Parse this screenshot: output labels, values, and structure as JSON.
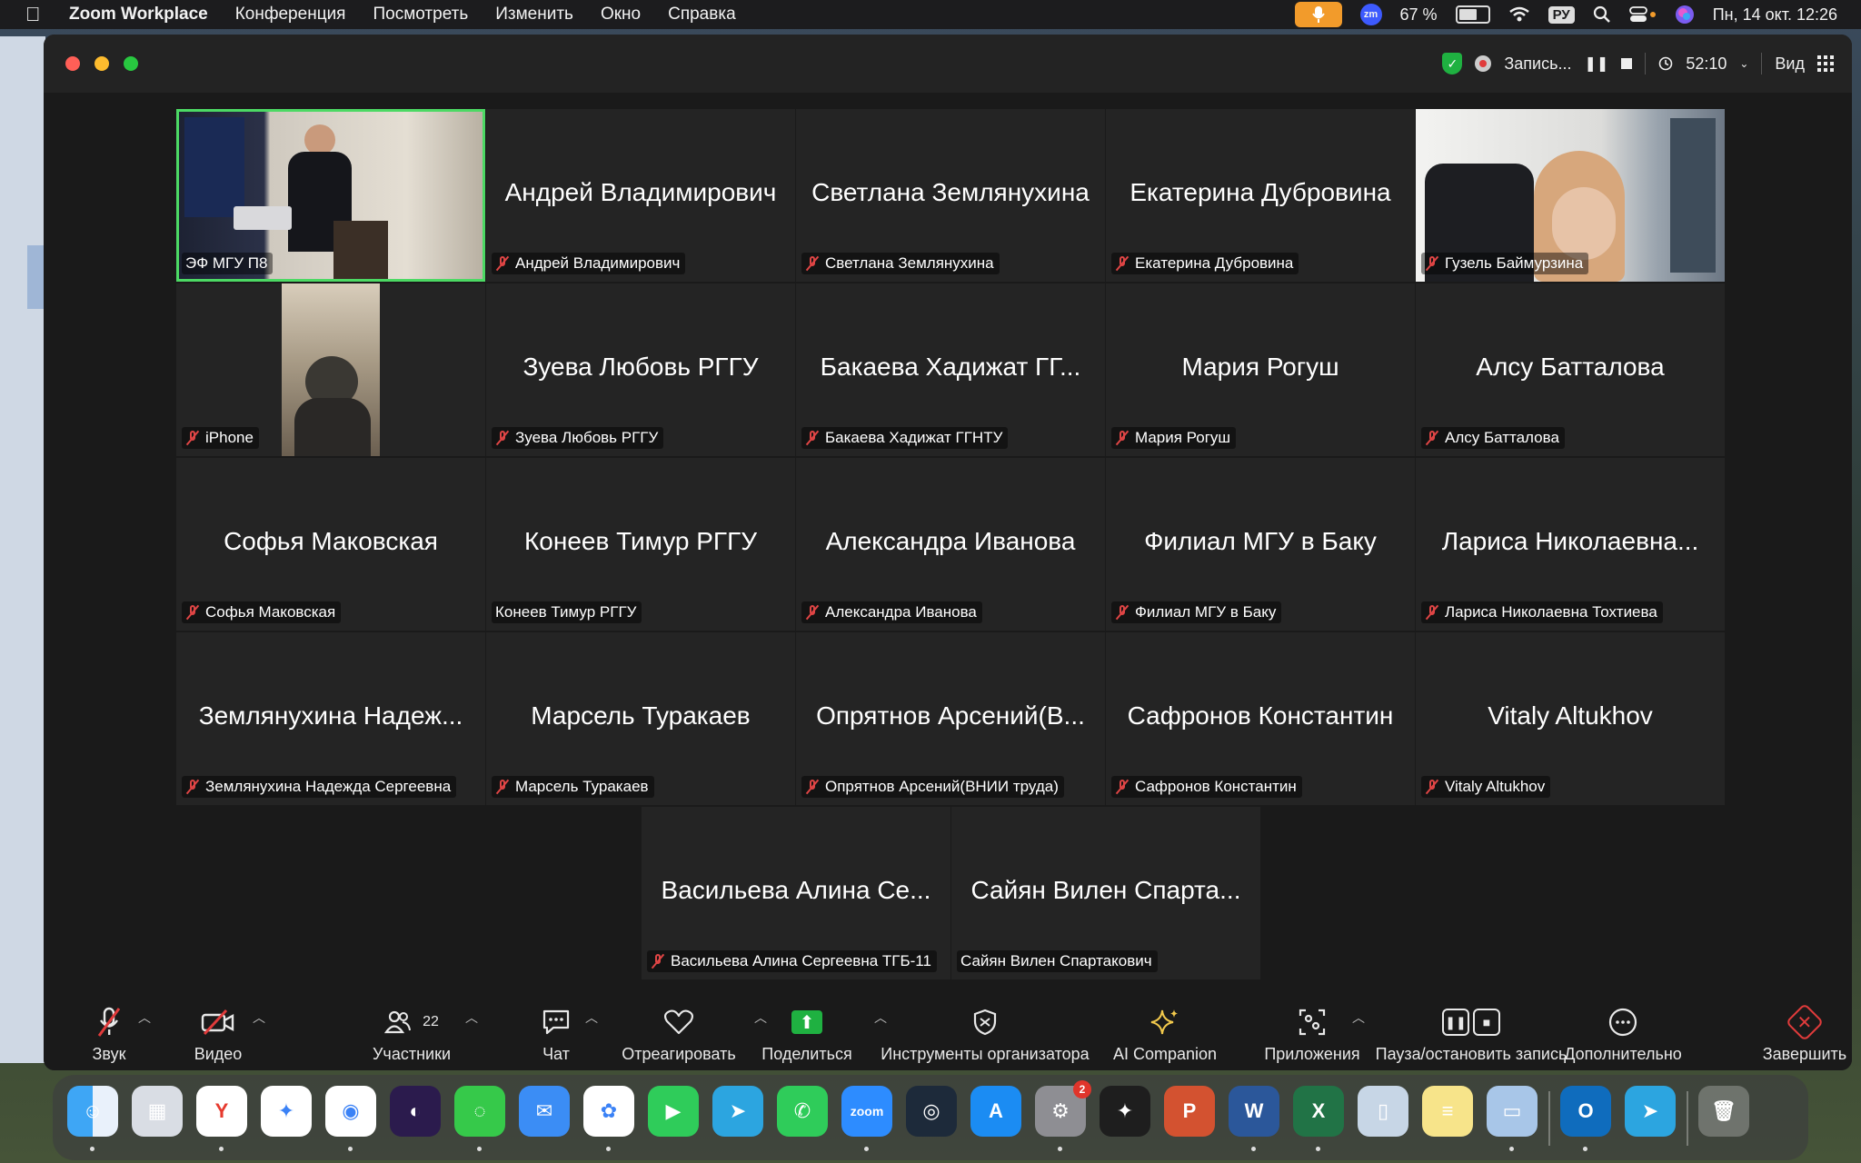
{
  "menubar": {
    "app_name": "Zoom Workplace",
    "items": [
      "Конференция",
      "Посмотреть",
      "Изменить",
      "Окно",
      "Справка"
    ],
    "zoom_badge": "zm",
    "battery": "67 %",
    "input_lang": "РУ",
    "datetime": "Пн, 14 окт.  12:26"
  },
  "titlebar": {
    "recording_label": "Запись...",
    "timer": "52:10",
    "view_label": "Вид"
  },
  "tiles": [
    {
      "type": "video",
      "label": "ЭФ МГУ П8",
      "muted": false,
      "active": true
    },
    {
      "name": "Андрей Владимирович",
      "label": "Андрей Владимирович",
      "muted": true
    },
    {
      "name": "Светлана Землянухина",
      "label": "Светлана Землянухина",
      "muted": true
    },
    {
      "name": "Екатерина Дубровина",
      "label": "Екатерина Дубровина",
      "muted": true
    },
    {
      "type": "video",
      "label": "Гузель Баймурзина",
      "muted": true
    },
    {
      "type": "video",
      "label": "iPhone",
      "muted": true
    },
    {
      "name": "Зуева Любовь РГГУ",
      "label": "Зуева Любовь РГГУ",
      "muted": true
    },
    {
      "name": "Бакаева Хадижат ГГ...",
      "label": "Бакаева Хадижат ГГНТУ",
      "muted": true
    },
    {
      "name": "Мария Рогуш",
      "label": "Мария Рогуш",
      "muted": true
    },
    {
      "name": "Алсу Батталова",
      "label": "Алсу Батталова",
      "muted": true
    },
    {
      "name": "Софья Маковская",
      "label": "Софья Маковская",
      "muted": true
    },
    {
      "name": "Конеев Тимур РГГУ",
      "label": "Конеев Тимур РГГУ",
      "muted": false
    },
    {
      "name": "Александра Иванова",
      "label": "Александра Иванова",
      "muted": true
    },
    {
      "name": "Филиал МГУ в Баку",
      "label": "Филиал МГУ в Баку",
      "muted": true
    },
    {
      "name": "Лариса Николаевна...",
      "label": "Лариса Николаевна Тохтиева",
      "muted": true
    },
    {
      "name": "Землянухина Надеж...",
      "label": "Землянухина Надежда Сергеевна",
      "muted": true
    },
    {
      "name": "Марсель Туракаев",
      "label": "Марсель Туракаев",
      "muted": true
    },
    {
      "name": "Опрятнов Арсений(В...",
      "label": "Опрятнов Арсений(ВНИИ труда)",
      "muted": true
    },
    {
      "name": "Сафронов Константин",
      "label": "Сафронов Константин",
      "muted": true
    },
    {
      "name": "Vitaly Altukhov",
      "label": "Vitaly Altukhov",
      "muted": true
    },
    {
      "name": "Васильева Алина Се...",
      "label": "Васильева Алина Сергеевна ТГБ-11",
      "muted": true
    },
    {
      "name": "Сайян Вилен Спарта...",
      "label": "Сайян Вилен Спартакович",
      "muted": false
    }
  ],
  "toolbar": {
    "audio": "Звук",
    "video": "Видео",
    "participants": "Участники",
    "participants_count": "22",
    "chat": "Чат",
    "react": "Отреагировать",
    "share": "Поделиться",
    "host_tools": "Инструменты организатора",
    "ai_companion": "AI Companion",
    "apps": "Приложения",
    "pause_record": "Пауза/остановить запись",
    "more": "Дополнительно",
    "end": "Завершить"
  },
  "dock": {
    "zoom_label": "zoom",
    "settings_badge": "2",
    "icons": [
      "finder-icon",
      "launchpad-icon",
      "yandex-browser-icon",
      "safari-icon",
      "chrome-icon",
      "firefox-icon",
      "messages-icon",
      "mail-icon",
      "photos-icon",
      "facetime-icon",
      "telegram-icon",
      "whatsapp-icon",
      "zoom-icon",
      "camera-app-icon",
      "app-store-icon",
      "system-settings-icon",
      "figma-icon",
      "powerpoint-icon",
      "word-icon",
      "excel-icon",
      "files-icon",
      "notes-icon",
      "preview-icon",
      "outlook-icon",
      "telegram-alt-icon",
      "trash-icon"
    ]
  }
}
